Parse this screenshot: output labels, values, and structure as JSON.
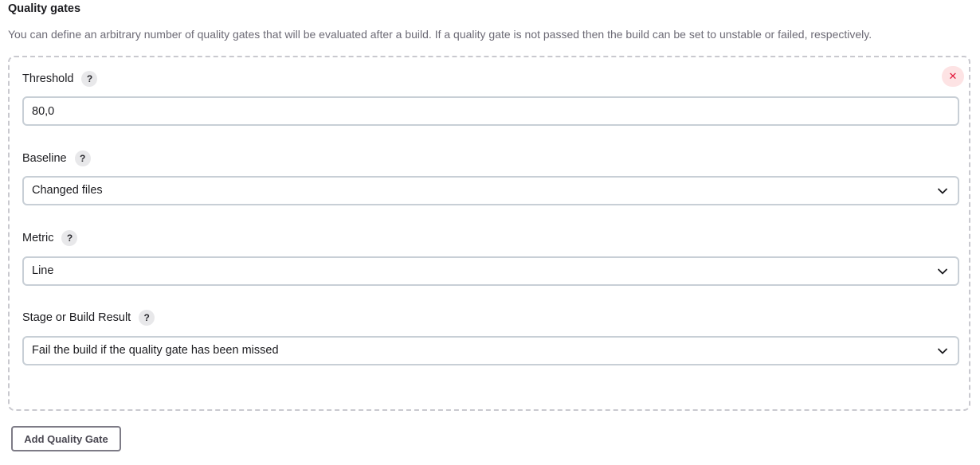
{
  "section": {
    "title": "Quality gates",
    "description": "You can define an arbitrary number of quality gates that will be evaluated after a build. If a quality gate is not passed then the build can be set to unstable or failed, respectively."
  },
  "gate": {
    "remove_icon": "close-icon",
    "remove_glyph": "✕",
    "help_glyph": "?",
    "threshold": {
      "label": "Threshold",
      "value": "80,0"
    },
    "baseline": {
      "label": "Baseline",
      "selected": "Changed files"
    },
    "metric": {
      "label": "Metric",
      "selected": "Line"
    },
    "stage_result": {
      "label": "Stage or Build Result",
      "selected": "Fail the build if the quality gate has been missed"
    }
  },
  "actions": {
    "add_label": "Add Quality Gate"
  },
  "colors": {
    "remove_accent": "#e2173a",
    "remove_bg": "#fde3e4",
    "border": "#c8cfd6",
    "dashed_border": "#c9c9cf"
  }
}
